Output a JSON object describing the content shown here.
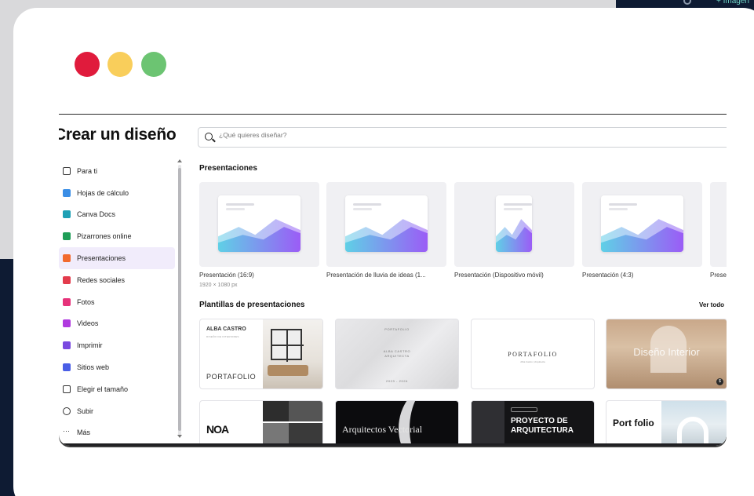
{
  "app": {
    "title": "Crear un diseño"
  },
  "search": {
    "placeholder": "¿Qué quieres diseñar?"
  },
  "sidebar": {
    "items": [
      {
        "label": "Para ti",
        "icon": "sparkle-icon",
        "color": "#333333"
      },
      {
        "label": "Hojas de cálculo",
        "icon": "spreadsheet-icon",
        "color": "#3a8ee6"
      },
      {
        "label": "Canva Docs",
        "icon": "doc-icon",
        "color": "#1fa0b5"
      },
      {
        "label": "Pizarrones online",
        "icon": "whiteboard-icon",
        "color": "#1f9e57"
      },
      {
        "label": "Presentaciones",
        "icon": "presentation-icon",
        "color": "#f26a2e",
        "active": true
      },
      {
        "label": "Redes sociales",
        "icon": "heart-icon",
        "color": "#e33b4c"
      },
      {
        "label": "Fotos",
        "icon": "camera-icon",
        "color": "#e6337a"
      },
      {
        "label": "Videos",
        "icon": "video-icon",
        "color": "#b03adf"
      },
      {
        "label": "Imprimir",
        "icon": "printer-icon",
        "color": "#7a4ae0"
      },
      {
        "label": "Sitios web",
        "icon": "website-icon",
        "color": "#4a5ee6"
      },
      {
        "label": "Elegir el tamaño",
        "icon": "resize-icon",
        "color": "#333333"
      },
      {
        "label": "Subir",
        "icon": "upload-icon",
        "color": "#333333"
      },
      {
        "label": "Más",
        "icon": "more-icon",
        "color": "#333333"
      }
    ]
  },
  "presentations": {
    "title": "Presentaciones",
    "items": [
      {
        "label": "Presentación (16:9)",
        "sub": "1920 × 1080 px"
      },
      {
        "label": "Presentación de lluvia de ideas (1..."
      },
      {
        "label": "Presentación (Dispositivo móvil)"
      },
      {
        "label": "Presentación (4:3)"
      },
      {
        "label": "Prese"
      }
    ]
  },
  "templates": {
    "title": "Plantillas de presentaciones",
    "see_all": "Ver todo",
    "t1": {
      "name": "ALBA CASTRO",
      "role": "DISEÑO DE INTERIORES",
      "word": "PORTAFOLIO"
    },
    "t2": {
      "top": "PORTAFOLIO",
      "mid1": "ALBA CASTRO",
      "mid2": "ARQUITECTA",
      "bottom": "2023 - 2024"
    },
    "t3": {
      "title": "PORTAFOLIO",
      "sub": "Alba Castro | Arquitecta"
    },
    "t4": {
      "title": "Diseño Interior"
    },
    "t5": {
      "title": "NOA"
    },
    "t6": {
      "title": "Arquitectos Vectorial"
    },
    "t7": {
      "title": "PROYECTO DE ARQUITECTURA"
    },
    "t8": {
      "title": "Port folio"
    }
  },
  "colors": {
    "accent": "#8b5cf6",
    "dot_red": "#e01b3c",
    "dot_yellow": "#f9ce5b",
    "dot_green": "#6cc472"
  }
}
